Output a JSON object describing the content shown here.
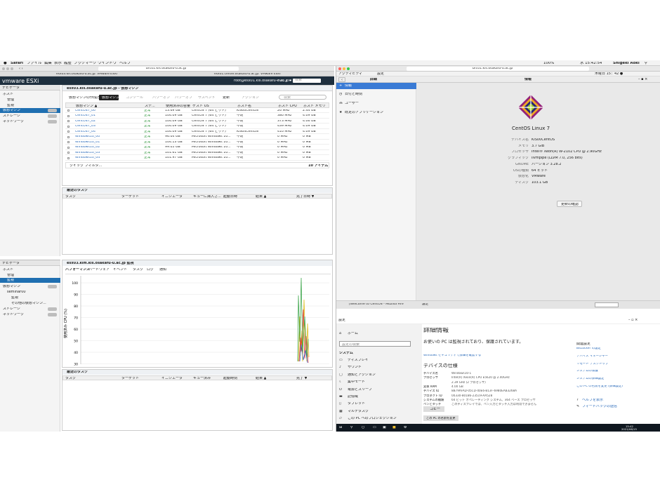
{
  "menubar": {
    "apple": "",
    "app": "Safari",
    "items": [
      "ファイル",
      "編集",
      "表示",
      "履歴",
      "ブックマーク",
      "ウインドウ",
      "ヘルプ"
    ],
    "right": "100%",
    "clock": "水 15:42:54",
    "user": "Shigeki Aoki"
  },
  "left_browser": {
    "url": "brc01.kis.osakafu-u.ac.jp",
    "tab1": "esx03.kis.osakafu-u.ac.jp: VMware ESXi",
    "tab2": "esx01.center.osakafu-u.ac.jp: VMware ESXi",
    "logo": "vmware ESXi",
    "user_menu": "root@esx01.kis.osakafu-u.ac.jp ▾",
    "help": "ヘルプ ▾",
    "search": "検索",
    "navigator": "ナビゲータ",
    "nav_items": [
      "ホスト",
      "管理",
      "監視",
      "仮想マシン",
      "ストレージ",
      "ネットワーク"
    ],
    "nav_counts": [
      "",
      "",
      "",
      "",
      "",
      ""
    ],
    "panel_title": "esx03.kis.osakafu-u.ac.jp - 仮想マシン",
    "toolbar": [
      "仮想マシンの作成/登録",
      "コンソール",
      "パワーオン",
      "パワーオフ",
      "サスペンド",
      "更新",
      "アクション"
    ],
    "tooltip": "仮想マシン",
    "filter": "検索",
    "columns": [
      "仮想マシン ▲",
      "ステ...",
      "使用済みの容量",
      "ゲスト OS",
      "ホスト名",
      "ホスト CPU",
      "ホスト メモリ"
    ],
    "rows": [
      [
        "CentOS7_00",
        "正常",
        "13.69 GB",
        "CentOS 7 (64 ビット)",
        "KIS00CentOS",
        "26 MHz",
        "2.44 GB"
      ],
      [
        "CentOS7_01",
        "正常",
        "104.09 GB",
        "CentOS 7 (64 ビット)",
        "不明",
        "380 MHz",
        "4.09 GB"
      ],
      [
        "CentOS7_02",
        "正常",
        "104.09 GB",
        "CentOS 7 (64 ビット)",
        "不明",
        "373 MHz",
        "4.06 GB"
      ],
      [
        "CentOS7_03",
        "正常",
        "104.09 GB",
        "CentOS 7 (64 ビット)",
        "不明",
        "439 MHz",
        "4.09 GB"
      ],
      [
        "CentOS7_04",
        "正常",
        "104.09 GB",
        "CentOS 7 (64 ビット)",
        "KIS04CentOS",
        "410 MHz",
        "4.09 GB"
      ],
      [
        "Windows10_00",
        "正常",
        "96.04 GB",
        "Microsoft Windows 10...",
        "不明",
        "0 MHz",
        "0 MB"
      ],
      [
        "Windows10_01",
        "正常",
        "104.13 GB",
        "Microsoft Windows 10...",
        "不明",
        "0 MHz",
        "0 MB"
      ],
      [
        "Windows10_02",
        "正常",
        "99.05 GB",
        "Microsoft Windows 10...",
        "不明",
        "0 MHz",
        "0 MB"
      ],
      [
        "Windows10_03",
        "正常",
        "101.61 GB",
        "Microsoft Windows 10...",
        "不明",
        "0 MHz",
        "0 MB"
      ],
      [
        "Windows10_04",
        "正常",
        "101.97 GB",
        "Microsoft Windows 10...",
        "不明",
        "0 MHz",
        "0 MB"
      ]
    ],
    "quickfilter": "クイック フィルタ...",
    "items_count": "10 アイテム",
    "tasks_title": "最近のタスク",
    "tasks_cols": [
      "タスク",
      "ターゲット",
      "イニシエータ",
      "キューに挿入さ...",
      "起動日時",
      "結果 ▲",
      "完了日時 ▼"
    ],
    "bottom_panel_title": "esx03.kim.kis.osakafu-u.ac.jp 監視",
    "bottom_tabs": [
      "パフォーマンス",
      "ハードウェア",
      "イベント",
      "タスク",
      "ログ",
      "通知"
    ],
    "bottom_nav": [
      "ホスト",
      "管理",
      "監視",
      "仮想マシン",
      "seminar00",
      "監視",
      "その他の仮想マシン...",
      "ストレージ",
      "ネットワーク"
    ],
    "chart_ylabel": "使用済み CPU (%)",
    "chart_yticks": [
      "100",
      "90",
      "80",
      "70",
      "60",
      "50",
      "40",
      "30"
    ],
    "bottom_tasks_cols": [
      "タスク",
      "ターゲット",
      "イニシエータ",
      "キュー済み",
      "起動時刻",
      "結果 ▲",
      "完了 ▼"
    ]
  },
  "right_top": {
    "activities": "アクティビティ",
    "app_menu": "設定",
    "url": "brc01.kis.osakafu-u.ac.jp",
    "clock": "木曜日 15：42 ●",
    "side_title": "詳細",
    "side_items": [
      "情報",
      "日付と時刻",
      "ユーザー",
      "既定のアプリケーション"
    ],
    "main_title": "情報",
    "distro": "CentOS Linux 7",
    "labels": [
      "デバイス名",
      "メモリ",
      "プロセッサ",
      "グラフィック",
      "GNOME",
      "OSの種類",
      "仮想化",
      "ディスク"
    ],
    "values": [
      "KIS00CentOS",
      "3.7 GiB",
      "Intel® Xeon(R) W-2102 CPU @ 2.90GHz",
      "llvmpipe (LLVM 7.0, 256 bits)",
      "バージョン 3.28.2",
      "64 ビット",
      "VMware",
      "103.1 GB"
    ],
    "update_btn": "更新の確認",
    "task_firefox": "[Welcome to CentOS - Mozilla Fire",
    "task_settings": "設定"
  },
  "right_bottom": {
    "title": "設定",
    "home": "ホーム",
    "search_ph": "設定の検索",
    "system": "システム",
    "menu": [
      "ディスプレイ",
      "サウンド",
      "通知とアクション",
      "集中モード",
      "電源とスリープ",
      "記憶域",
      "タブレット",
      "マルチタスク",
      "この PC へのプロジェクション"
    ],
    "heading": "詳細情報",
    "protect": "お使いの PC は監視されており、保護されています。",
    "sec_link": "Windows セキュリティで詳細を確認する",
    "spec_title": "デバイスの仕様",
    "spec_labels": [
      "デバイス名",
      "プロセッサ",
      "",
      "実装 RAM",
      "デバイス ID",
      "プロダクト ID",
      "システムの種類",
      "ペンとタッチ"
    ],
    "spec_values": [
      "Windows10-1",
      "Intel(R) Xeon(R) CPU     E5620 @ 2.40GHz",
      "2.39 GHz (2 プロセッサ)",
      "4.00 GB",
      "8B79AFAD-05CD-40E6-B13F-6980EAB3268A",
      "00330-80186-23519-AA528",
      "64 ビット オペレーティング システム、x64 ベース プロセッサ",
      "このディスプレイでは、ペン入力とタッチ入力は利用できません"
    ],
    "copy_btn": "コピー",
    "rename_btn": "この PC の名前を変更",
    "related_title": "関連設定",
    "related": [
      "BitLocker の設定",
      "デバイス マネージャー",
      "リモート デスクトップ",
      "システムの保護",
      "システムの詳細設定",
      "この PC の名前を変更 (詳細設定)"
    ],
    "help": "ヘルプを表示",
    "feedback": "フィードバックの送信",
    "tray_time": "15:42",
    "tray_date": "2021/06/15"
  },
  "chart_data": {
    "type": "line",
    "title": "",
    "xlabel": "",
    "ylabel": "使用済み CPU (%)",
    "ylim": [
      30,
      100
    ],
    "series": []
  }
}
